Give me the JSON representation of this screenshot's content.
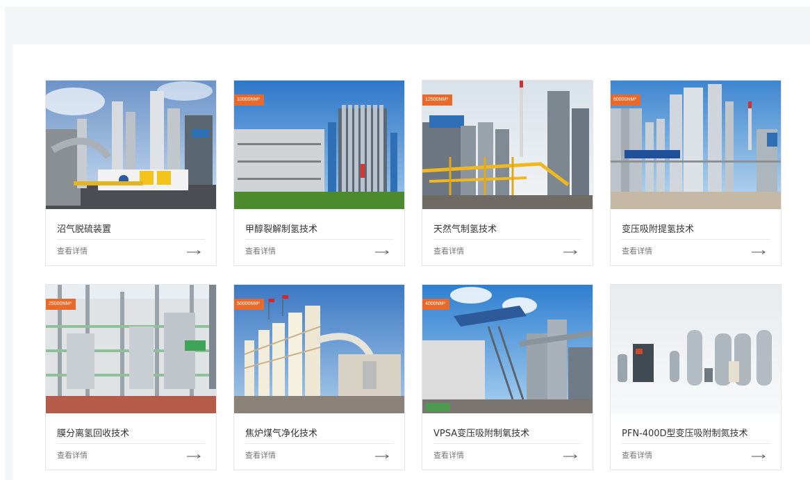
{
  "products": [
    {
      "title": "沼气脱硫装置",
      "link": "查看详情",
      "badge": "",
      "scene": "biogas"
    },
    {
      "title": "甲醇裂解制氢技术",
      "link": "查看详情",
      "badge": "10000NM³",
      "scene": "methanol"
    },
    {
      "title": "天然气制氢技术",
      "link": "查看详情",
      "badge": "12500NM³",
      "scene": "natgas"
    },
    {
      "title": "变压吸附提氢技术",
      "link": "查看详情",
      "badge": "60000NM³",
      "scene": "psa"
    },
    {
      "title": "膜分离氢回收技术",
      "link": "查看详情",
      "badge": "25000NM³",
      "scene": "membrane"
    },
    {
      "title": "焦炉煤气净化技术",
      "link": "查看详情",
      "badge": "50000NM³",
      "scene": "coke"
    },
    {
      "title": "VPSA变压吸附制氧技术",
      "link": "查看详情",
      "badge": "4000NM³",
      "scene": "vpsa"
    },
    {
      "title": "PFN-400D型变压吸附制氮技术",
      "link": "查看详情",
      "badge": "",
      "scene": "nitrogen"
    }
  ],
  "colors": {
    "badge": "#e8692a",
    "page_bg": "#f4f5f7",
    "border": "#e5e5e5"
  }
}
